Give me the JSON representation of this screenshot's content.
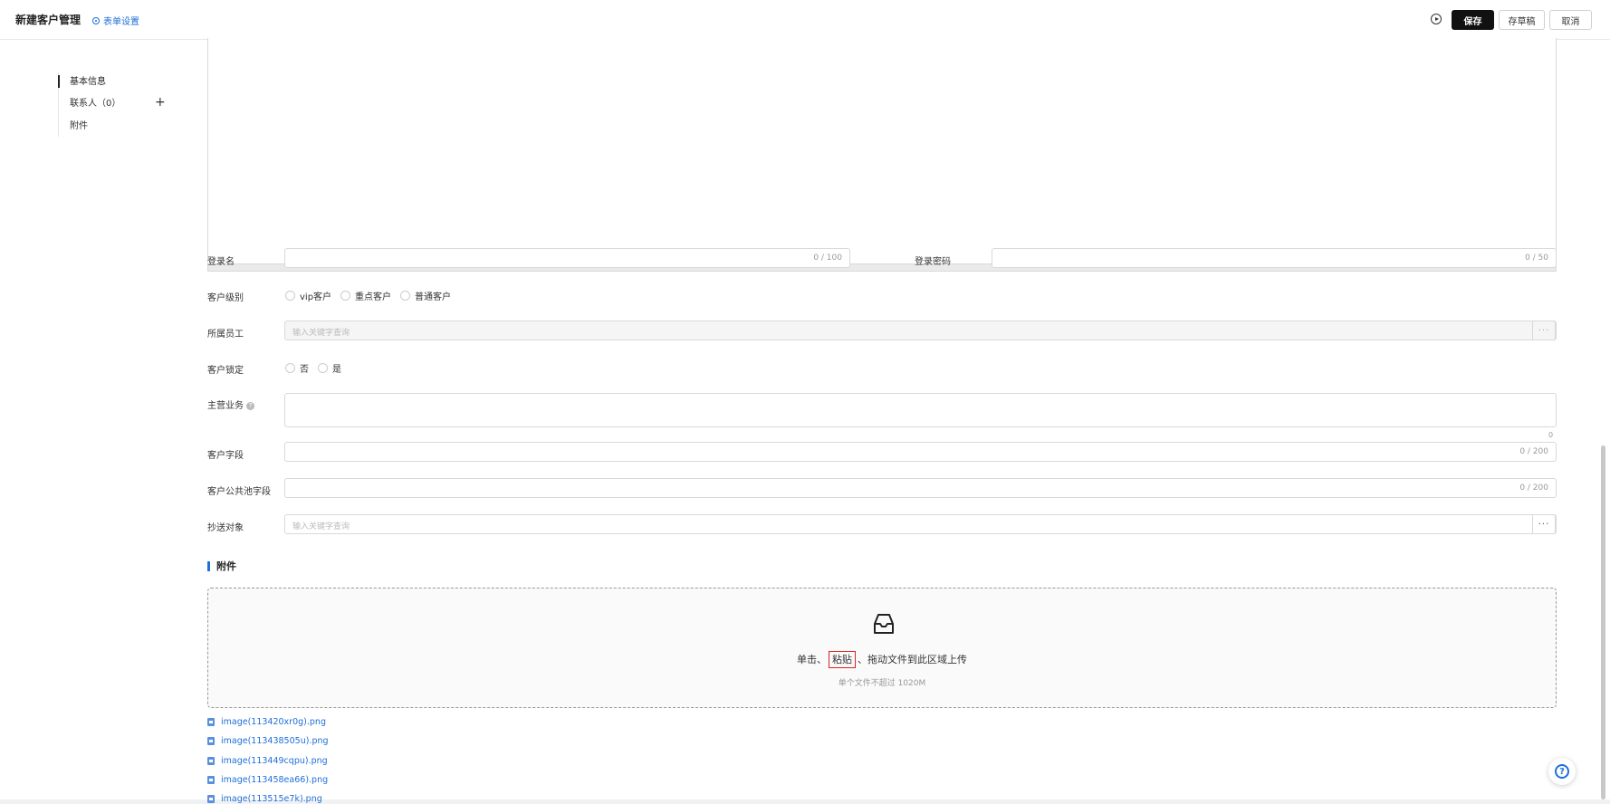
{
  "header": {
    "title": "新建客户管理",
    "form_settings": "表单设置",
    "save": "保存",
    "save_draft": "存草稿",
    "cancel": "取消"
  },
  "sidebar": {
    "items": [
      {
        "label": "基本信息",
        "active": true
      },
      {
        "label": "联系人（0）",
        "active": false
      },
      {
        "label": "附件",
        "active": false
      }
    ],
    "add_icon": "+"
  },
  "form": {
    "login_name": {
      "label": "登录名",
      "value": "",
      "count": "0 / 100"
    },
    "login_password": {
      "label": "登录密码",
      "value": "",
      "count": "0 / 50"
    },
    "customer_level": {
      "label": "客户级别",
      "options": [
        "vip客户",
        "重点客户",
        "普通客户"
      ]
    },
    "owner": {
      "label": "所属员工",
      "placeholder": "输入关键字查询",
      "more": "···"
    },
    "locked": {
      "label": "客户锁定",
      "options": [
        "否",
        "是"
      ]
    },
    "main_business": {
      "label": "主营业务",
      "help": "?",
      "value": "",
      "count": "0"
    },
    "customer_field": {
      "label": "客户字段",
      "value": "",
      "count": "0 / 200"
    },
    "public_pool_field": {
      "label": "客户公共池字段",
      "value": "",
      "count": "0 / 200"
    },
    "cc": {
      "label": "抄送对象",
      "placeholder": "输入关键字查询",
      "more": "···"
    }
  },
  "attachments": {
    "title": "附件",
    "upload_hint_prefix": "单击、",
    "upload_hint_paste": "粘贴",
    "upload_hint_suffix": "、拖动文件到此区域上传",
    "upload_limit": "单个文件不超过 1020M",
    "files": [
      "image(113420xr0g).png",
      "image(113438505u).png",
      "image(113449cqpu).png",
      "image(113458ea66).png",
      "image(113515e7k).png"
    ]
  },
  "help_button": "?",
  "colors": {
    "accent": "#1e6fd9",
    "primary_button": "#111111",
    "highlight_border": "#e02020"
  }
}
